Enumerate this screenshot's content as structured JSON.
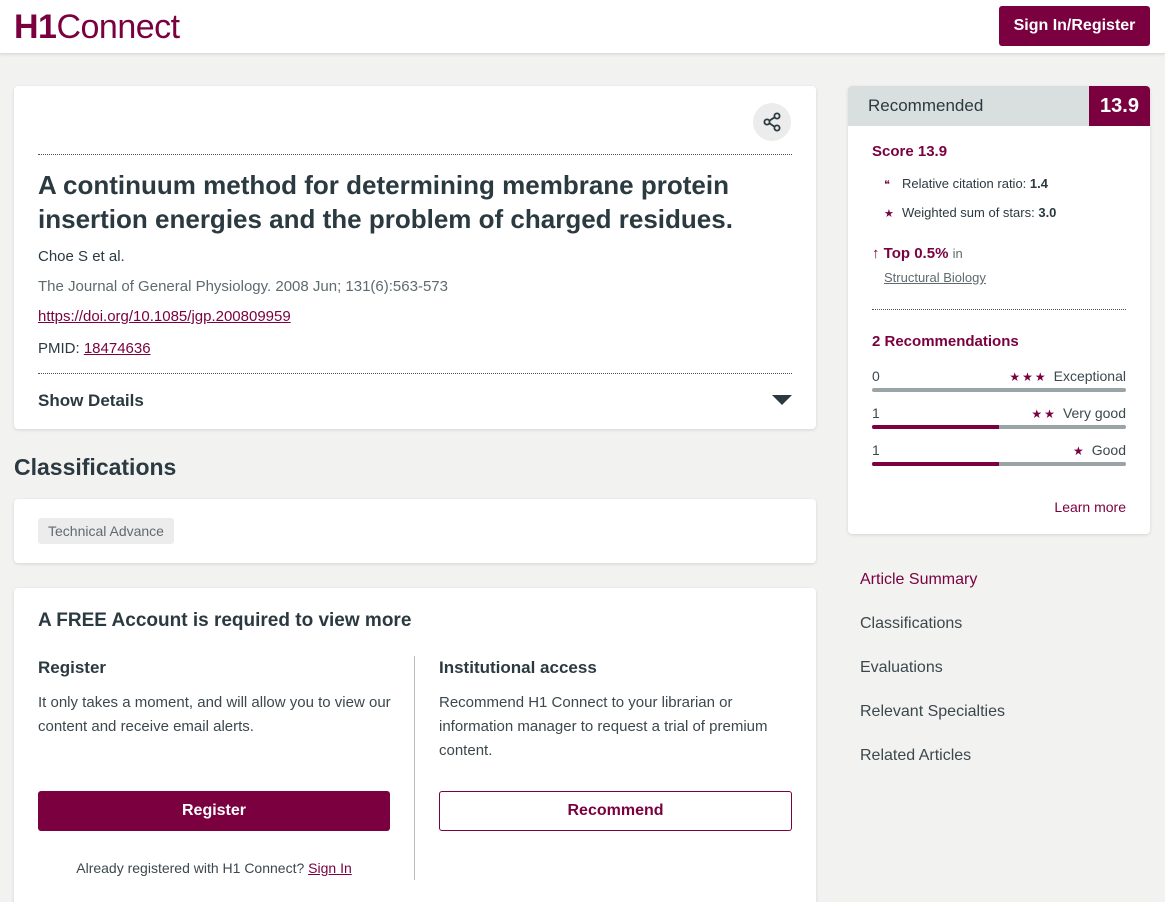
{
  "header": {
    "logo_bold": "H1",
    "logo_rest": "Connect",
    "signin_label": "Sign In/Register"
  },
  "article": {
    "title": "A continuum method for determining membrane protein insertion energies and the problem of charged residues.",
    "authors": "Choe S et al.",
    "journal": "The Journal of General Physiology. 2008 Jun; 131(6):563-573",
    "doi": "https://doi.org/10.1085/jgp.200809959",
    "pmid_label": "PMID:",
    "pmid": "18474636",
    "show_details": "Show Details"
  },
  "classifications": {
    "heading": "Classifications",
    "tags": [
      "Technical Advance"
    ]
  },
  "account": {
    "heading": "A FREE Account is required to view more",
    "register": {
      "title": "Register",
      "text": "It only takes a moment, and will allow you to view our content and receive email alerts.",
      "button": "Register",
      "already": "Already registered with H1 Connect?",
      "signin": "Sign In"
    },
    "institutional": {
      "title": "Institutional access",
      "text": "Recommend H1 Connect to your librarian or information manager to request a trial of premium content.",
      "button": "Recommend"
    }
  },
  "recommended": {
    "label": "Recommended",
    "score": "13.9",
    "score_text": "Score 13.9",
    "citation_label": "Relative citation ratio:",
    "citation_value": "1.4",
    "stars_label": "Weighted sum of stars:",
    "stars_value": "3.0",
    "top_label": "Top 0.5%",
    "top_in": "in",
    "specialty": "Structural Biology",
    "rec_count": "2 Recommendations",
    "rows": [
      {
        "count": "0",
        "stars": "★★★",
        "label": "Exceptional",
        "fraction": 0
      },
      {
        "count": "1",
        "stars": "★★",
        "label": "Very good",
        "fraction": 0.5
      },
      {
        "count": "1",
        "stars": "★",
        "label": "Good",
        "fraction": 0.5
      }
    ],
    "learn_more": "Learn more"
  },
  "sidenav": [
    "Article Summary",
    "Classifications",
    "Evaluations",
    "Relevant Specialties",
    "Related Articles"
  ],
  "colors": {
    "brand": "#7a0040",
    "text": "#2b3a40"
  }
}
